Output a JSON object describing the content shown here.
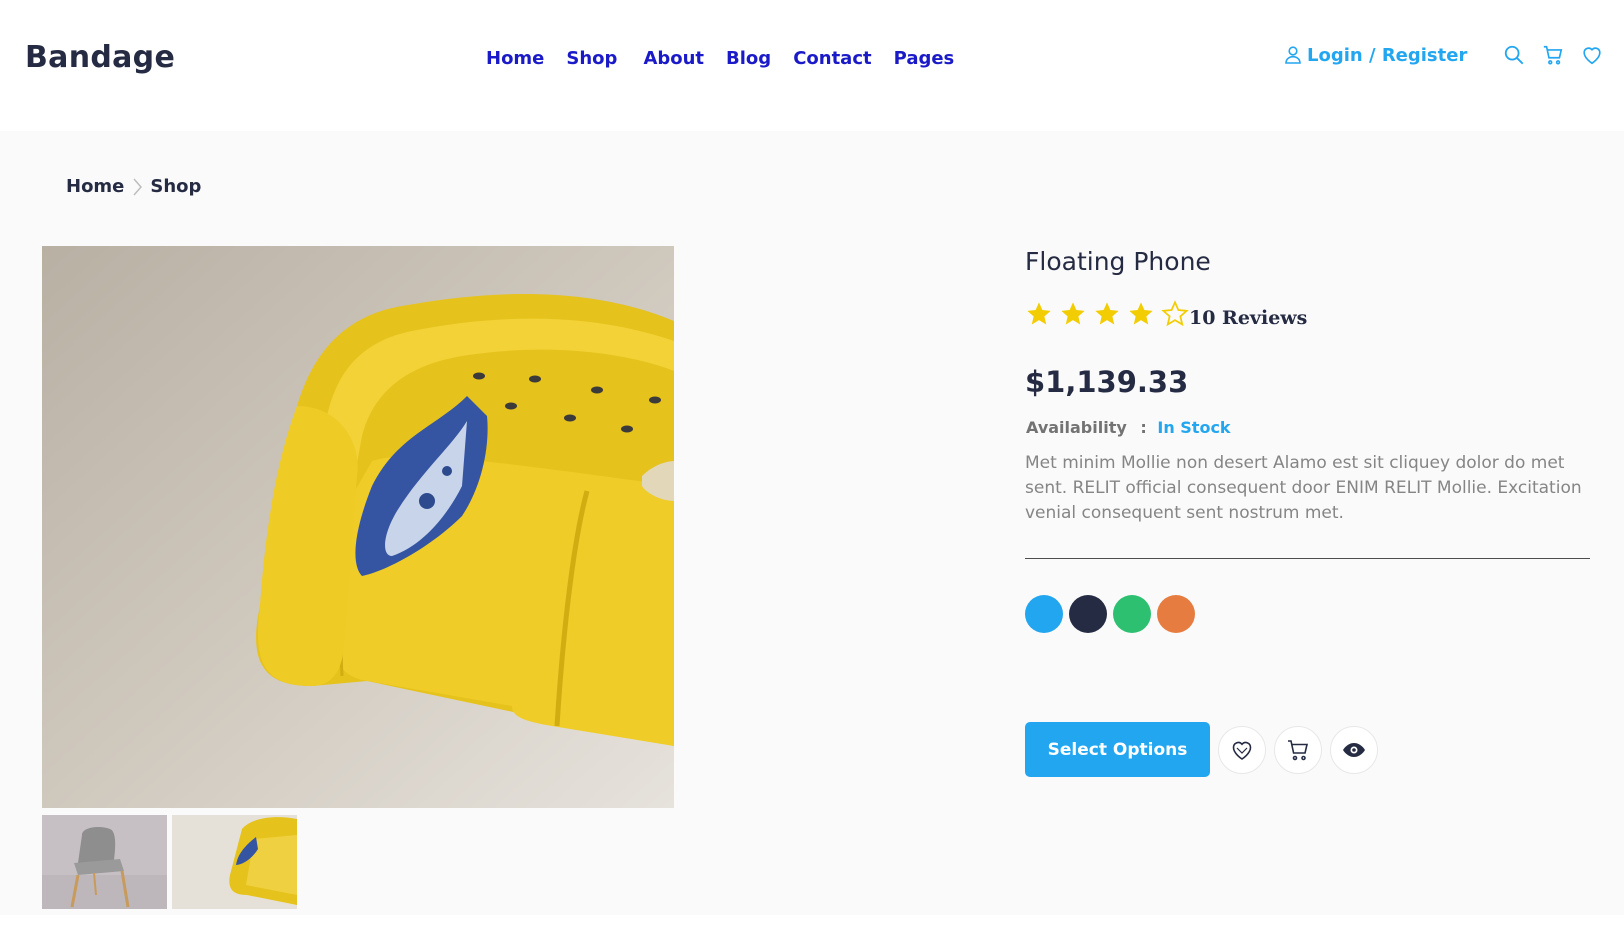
{
  "header": {
    "brand": "Bandage",
    "nav": [
      "Home",
      "Shop",
      "About",
      "Blog",
      "Contact",
      "Pages"
    ],
    "login_label": "Login / Register",
    "icons": [
      "search-icon",
      "cart-icon",
      "heart-icon"
    ]
  },
  "breadcrumb": [
    "Home",
    "Shop"
  ],
  "gallery": {
    "main_image": "yellow-sofa-photo",
    "thumbnails": [
      "grey-chair-photo",
      "yellow-sofa-photo"
    ]
  },
  "product": {
    "title": "Floating Phone",
    "rating": 4,
    "rating_max": 5,
    "reviews_label": "10 Reviews",
    "price": "$1,139.33",
    "availability_label": "Availability",
    "availability_sep": ":",
    "availability_value": "In Stock",
    "description": "Met minim Mollie non desert Alamo est sit cliquey dolor do met sent. RELIT official consequent door ENIM RELIT Mollie. Excitation venial consequent sent nostrum met.",
    "colors": [
      "#23a6f0",
      "#252b42",
      "#2dc071",
      "#e77c40"
    ]
  },
  "actions": {
    "select_options": "Select Options",
    "icons": [
      "heart-icon",
      "cart-icon",
      "eye-icon"
    ]
  },
  "colors": {
    "accent": "#23a6f0",
    "nav_link": "#1a1ac8",
    "text_dark": "#252b42",
    "star": "#f3cd03",
    "background": "#fafafa"
  }
}
